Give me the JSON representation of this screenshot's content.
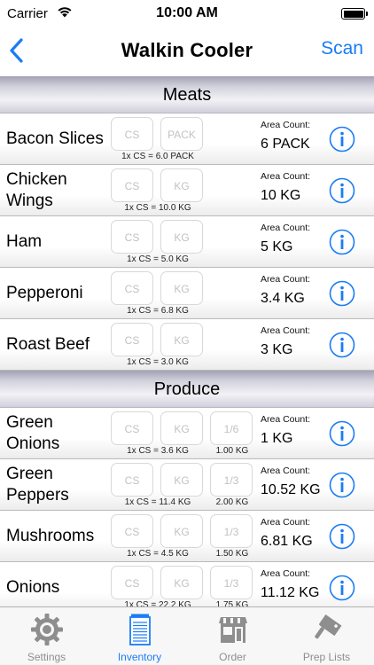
{
  "status_bar": {
    "carrier": "Carrier",
    "time": "10:00 AM"
  },
  "nav": {
    "title": "Walkin Cooler",
    "right_button": "Scan"
  },
  "sections": [
    {
      "title": "Meats",
      "items": [
        {
          "name": "Bacon Slices",
          "boxes": [
            "CS",
            "PACK"
          ],
          "conversion": "1x CS = 6.0 PACK",
          "area_count_label": "Area Count:",
          "area_count": "6 PACK"
        },
        {
          "name": "Chicken Wings",
          "boxes": [
            "CS",
            "KG"
          ],
          "conversion": "1x CS = 10.0 KG",
          "area_count_label": "Area Count:",
          "area_count": "10 KG"
        },
        {
          "name": "Ham",
          "boxes": [
            "CS",
            "KG"
          ],
          "conversion": "1x CS = 5.0 KG",
          "area_count_label": "Area Count:",
          "area_count": "5 KG"
        },
        {
          "name": "Pepperoni",
          "boxes": [
            "CS",
            "KG"
          ],
          "conversion": "1x CS = 6.8 KG",
          "area_count_label": "Area Count:",
          "area_count": "3.4 KG"
        },
        {
          "name": "Roast Beef",
          "boxes": [
            "CS",
            "KG"
          ],
          "conversion": "1x CS = 3.0 KG",
          "area_count_label": "Area Count:",
          "area_count": "3 KG"
        }
      ]
    },
    {
      "title": "Produce",
      "items": [
        {
          "name": "Green Onions",
          "boxes": [
            "CS",
            "KG",
            "1/6"
          ],
          "conversion": "1x CS = 3.6 KG",
          "conversion_3": "1.00 KG",
          "area_count_label": "Area Count:",
          "area_count": "1 KG"
        },
        {
          "name": "Green Peppers",
          "boxes": [
            "CS",
            "KG",
            "1/3"
          ],
          "conversion": "1x CS = 11.4 KG",
          "conversion_3": "2.00 KG",
          "area_count_label": "Area Count:",
          "area_count": "10.52 KG"
        },
        {
          "name": "Mushrooms",
          "boxes": [
            "CS",
            "KG",
            "1/3"
          ],
          "conversion": "1x CS = 4.5 KG",
          "conversion_3": "1.50 KG",
          "area_count_label": "Area Count:",
          "area_count": "6.81 KG"
        },
        {
          "name": "Onions",
          "boxes": [
            "CS",
            "KG",
            "1/3"
          ],
          "conversion": "1x CS = 22.2 KG",
          "conversion_3": "1.75 KG",
          "area_count_label": "Area Count:",
          "area_count": "11.12 KG"
        }
      ]
    }
  ],
  "tabs": [
    {
      "label": "Settings",
      "icon": "gear-icon",
      "active": false
    },
    {
      "label": "Inventory",
      "icon": "clipboard-icon",
      "active": true
    },
    {
      "label": "Order",
      "icon": "storefront-icon",
      "active": false
    },
    {
      "label": "Prep Lists",
      "icon": "cleaver-icon",
      "active": false
    }
  ],
  "colors": {
    "accent": "#1a7cf5",
    "tab_inactive": "#8e8e8e",
    "placeholder": "#c2c2c2"
  }
}
